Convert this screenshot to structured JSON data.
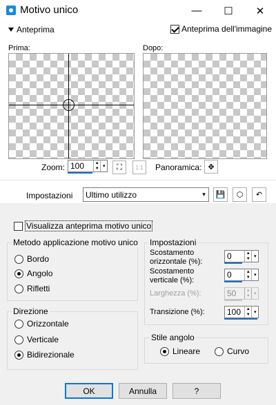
{
  "window": {
    "title": "Motivo unico",
    "minimize_glyph": "—",
    "maximize_glyph": "☐",
    "close_glyph": "✕"
  },
  "preview": {
    "toggle_label": "Anteprima",
    "image_preview_label": "Anteprima dell'immagine",
    "image_preview_checked": true,
    "before_label": "Prima:",
    "after_label": "Dopo:",
    "zoom_label": "Zoom:",
    "zoom_value": "100",
    "pan_label": "Panoramica:"
  },
  "presets": {
    "label": "Impostazioni",
    "value": "Ultimo utilizzo"
  },
  "show_preview": {
    "label": "Visualizza anteprima motivo unico",
    "checked": false
  },
  "method_group": {
    "title": "Metodo applicazione motivo unico",
    "options": [
      {
        "label": "Bordo",
        "checked": false
      },
      {
        "label": "Angolo",
        "checked": true
      },
      {
        "label": "Rifletti",
        "checked": false
      }
    ]
  },
  "direction_group": {
    "title": "Direzione",
    "options": [
      {
        "label": "Orizzontale",
        "checked": false
      },
      {
        "label": "Verticale",
        "checked": false
      },
      {
        "label": "Bidirezionale",
        "checked": true
      }
    ]
  },
  "settings_group": {
    "title": "Impostazioni",
    "h_offset_label_1": "Scostamento",
    "h_offset_label_2": "orizzontale (%):",
    "h_offset_value": "0",
    "v_offset_label_1": "Scostamento",
    "v_offset_label_2": "verticale (%):",
    "v_offset_value": "0",
    "width_label": "Larghezza (%):",
    "width_value": "50",
    "transition_label": "Transizione (%):",
    "transition_value": "100"
  },
  "corner_style_group": {
    "title": "Stile angolo",
    "options": [
      {
        "label": "Lineare",
        "checked": true
      },
      {
        "label": "Curvo",
        "checked": false
      }
    ]
  },
  "buttons": {
    "ok": "OK",
    "cancel": "Annulla",
    "help": "?"
  }
}
